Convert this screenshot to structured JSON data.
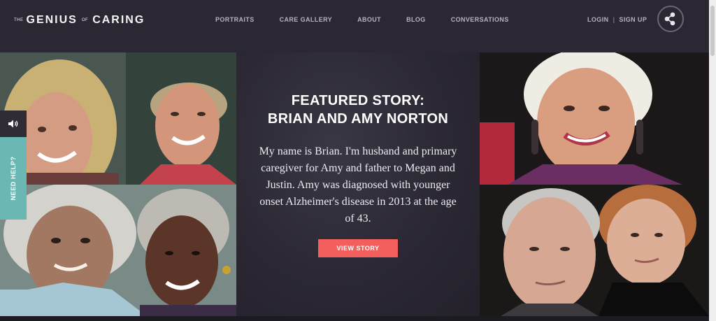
{
  "header": {
    "logo": {
      "the": "THE",
      "genius": "GENIUS",
      "of": "OF",
      "caring": "CARING"
    },
    "nav": [
      "PORTRAITS",
      "CARE GALLERY",
      "ABOUT",
      "BLOG",
      "CONVERSATIONS"
    ],
    "login": "LOGIN",
    "separator": "|",
    "signup": "SIGN UP",
    "share_icon": "share-icon"
  },
  "featured": {
    "title_line1": "FEATURED STORY:",
    "title_line2": "BRIAN AND AMY NORTON",
    "body": "My name is Brian. I'm husband and primary caregiver for Amy and father to Megan and Justin. Amy was diagnosed with younger onset Alzheimer's disease in 2013 at the age of 43.",
    "button": "VIEW STORY"
  },
  "side": {
    "sound_icon": "speaker-icon",
    "help": "NEED HELP?"
  },
  "colors": {
    "background": "#26232d",
    "header": "#2b2834",
    "accent_button": "#f25f5c",
    "help_tab": "#6ab7b4"
  }
}
